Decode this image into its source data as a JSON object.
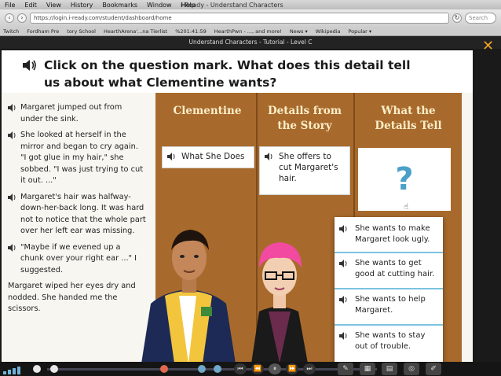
{
  "menubar": {
    "items": [
      "File",
      "Edit",
      "View",
      "History",
      "Bookmarks",
      "Window",
      "Help"
    ],
    "window_title": "i-Ready - Understand Characters"
  },
  "browser": {
    "url": "https://login.i-ready.com/student/dashboard/home",
    "search_placeholder": "Search"
  },
  "bookmarks": [
    "Twitch",
    "Fordham Pre",
    "tory School",
    "HearthArena'...na Tierlist",
    "%201:41:59",
    "HearthPwn - ..., and more!",
    "News ▾",
    "Wikipedia",
    "Popular ▾"
  ],
  "app": {
    "title": "Understand Characters - Tutorial - Level C"
  },
  "prompt": "Click on the question mark. What does this detail tell us about what Clementine wants?",
  "passage": [
    "Margaret jumped out from under the sink.",
    "She looked at herself in the mirror and began to cry again. \"I got glue in my hair,\" she sobbed. \"I was just trying to cut it out. ...\"",
    "Margaret's hair was halfway-down-her-back long. It was hard not to notice that the whole part over her left ear was missing.",
    "\"Maybe if we evened up a chunk over your right ear ...\" I suggested.",
    "Margaret wiped her eyes dry and nodded. She handed me the scissors."
  ],
  "columns": {
    "col1": "Clementine",
    "col2": "Details from the Story",
    "col3": "What the Details Tell"
  },
  "cards": {
    "what_she_does": "What She Does",
    "detail": "She offers to cut Margaret's hair.",
    "question": "?"
  },
  "options": [
    "She wants to make Margaret look ugly.",
    "She wants to get good at cutting hair.",
    "She wants to help Margaret.",
    "She wants to stay out of trouble."
  ],
  "controls": {
    "rewind": "⏮",
    "back": "⏪",
    "pause": "⏸",
    "forward": "⏩",
    "skip": "⏭"
  },
  "colors": {
    "board": "#a86a2c",
    "accent": "#4aa0c8",
    "close": "#f1a32a"
  }
}
